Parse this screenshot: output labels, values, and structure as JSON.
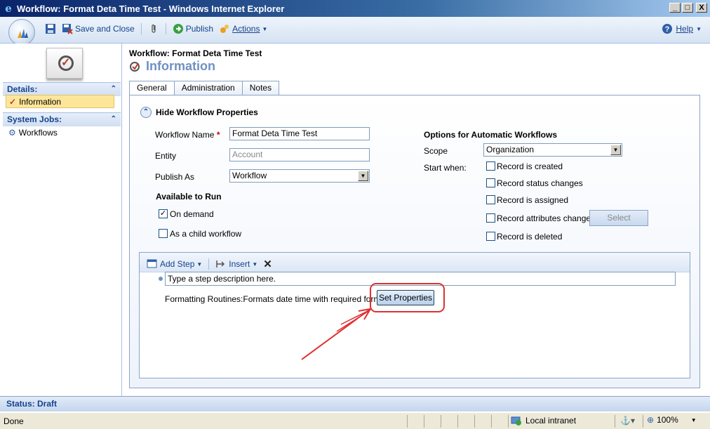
{
  "window": {
    "title": "Workflow: Format Deta Time Test - Windows Internet Explorer",
    "controls": [
      "_",
      "□",
      "X"
    ]
  },
  "toolbar": {
    "save_close_label": "Save and Close",
    "publish_label": "Publish",
    "actions_label": "Actions",
    "help_label": "Help"
  },
  "nav": {
    "details_header": "Details:",
    "information_label": "Information",
    "system_jobs_header": "System Jobs:",
    "workflows_label": "Workflows"
  },
  "header": {
    "breadcrumb": "Workflow: Format Deta Time Test",
    "title": "Information"
  },
  "tabs": [
    "General",
    "Administration",
    "Notes"
  ],
  "form": {
    "hide_properties_label": "Hide Workflow Properties",
    "workflow_name_label": "Workflow Name",
    "required_marker": "*",
    "workflow_name_value": "Format Deta Time Test",
    "entity_label": "Entity",
    "entity_value": "Account",
    "publish_as_label": "Publish As",
    "publish_as_value": "Workflow",
    "available_to_run_header": "Available to Run",
    "on_demand_label": "On demand",
    "on_demand_checked": true,
    "child_workflow_label": "As a child workflow",
    "child_workflow_checked": false
  },
  "automatic": {
    "header": "Options for Automatic Workflows",
    "scope_label": "Scope",
    "scope_value": "Organization",
    "start_when_label": "Start when:",
    "options": [
      {
        "label": "Record is created",
        "checked": false
      },
      {
        "label": "Record status changes",
        "checked": false
      },
      {
        "label": "Record is assigned",
        "checked": false
      },
      {
        "label": "Record attributes change",
        "checked": false
      },
      {
        "label": "Record is deleted",
        "checked": false
      }
    ],
    "select_label": "Select"
  },
  "designer": {
    "add_step_label": "Add Step",
    "insert_label": "Insert",
    "delete_glyph": "✕",
    "step_placeholder": "Type a step description here.",
    "step_text": "Formatting Routines:Formats date time with required format",
    "set_properties_label": "Set Properties"
  },
  "status": {
    "crm_status": "Status: Draft",
    "ie_status": "Done",
    "zone": "Local intranet",
    "zoom": "100%"
  },
  "colors": {
    "brand_blue": "#15428b",
    "annotation_red": "#e03030",
    "title_accent": "#6f91c0"
  }
}
